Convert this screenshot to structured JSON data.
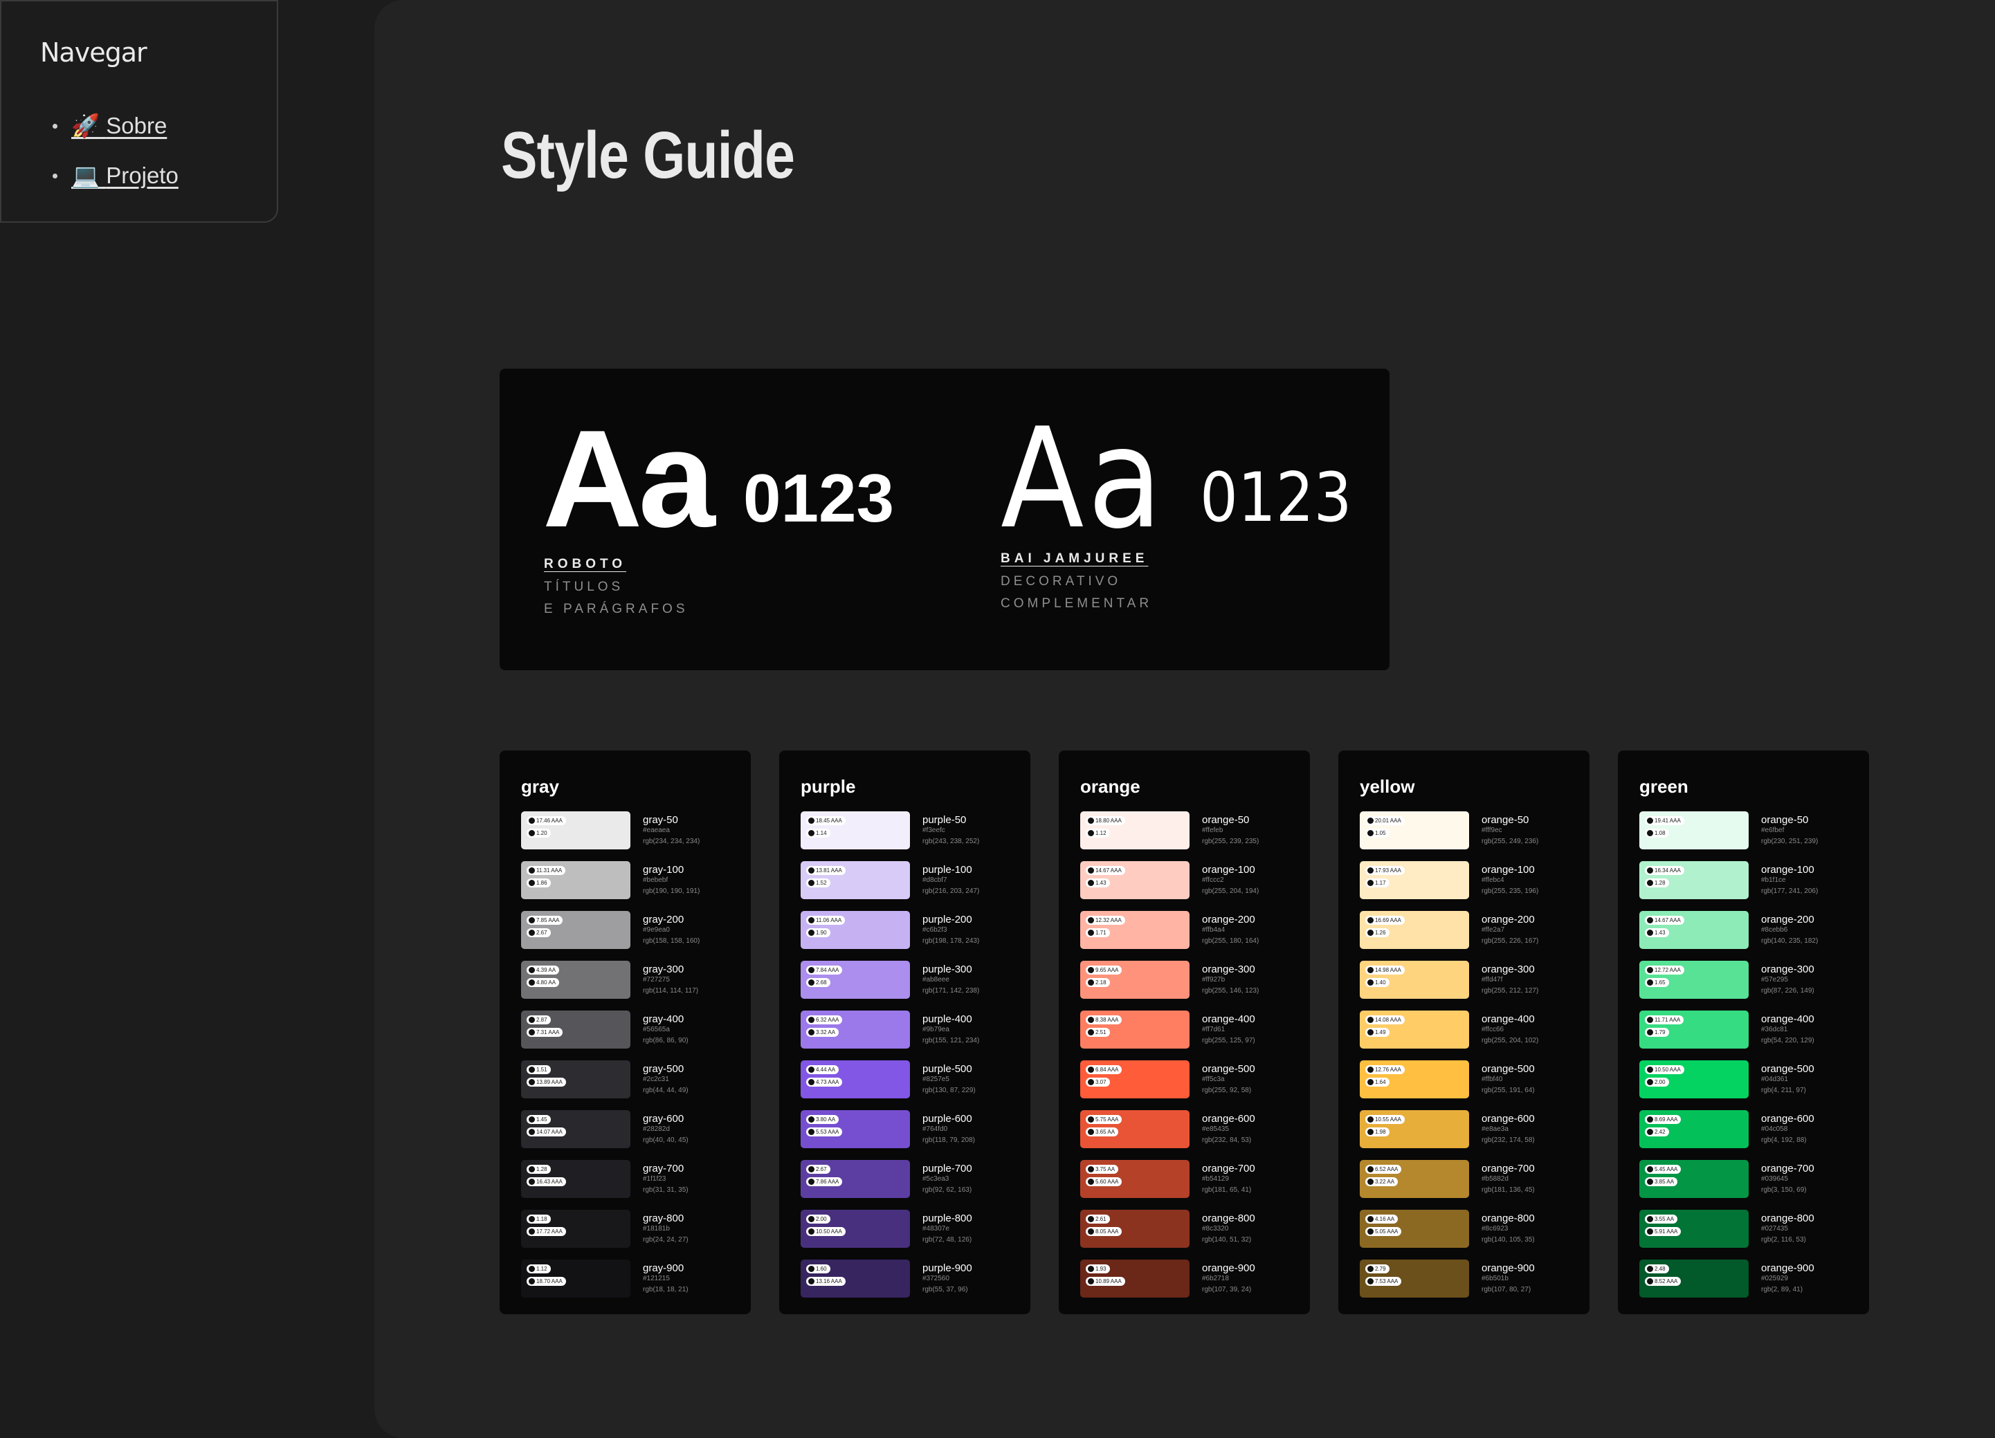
{
  "nav": {
    "title": "Navegar",
    "items": [
      {
        "icon": "🚀",
        "label": "Sobre"
      },
      {
        "icon": "💻",
        "label": "Projeto"
      }
    ]
  },
  "page": {
    "title": "Style Guide"
  },
  "typography": [
    {
      "sample": "Aa",
      "digits": "0123",
      "name": "ROBOTO",
      "desc1": "TÍTULOS",
      "desc2": "E PARÁGRAFOS"
    },
    {
      "sample": "Aa",
      "digits": "0123",
      "name": "BAI JAMJUREE",
      "desc1": "DECORATIVO",
      "desc2": "COMPLEMENTAR"
    }
  ],
  "palettes": [
    {
      "name": "gray",
      "colors": [
        {
          "label": "gray-50",
          "hex": "#eaeaea",
          "rgb": "rgb(234, 234, 234)",
          "c1": "17.46 AAA",
          "c2": "1.20",
          "color": "#eaeaea"
        },
        {
          "label": "gray-100",
          "hex": "#bebebf",
          "rgb": "rgb(190, 190, 191)",
          "c1": "11.31 AAA",
          "c2": "1.86",
          "color": "#bebebf"
        },
        {
          "label": "gray-200",
          "hex": "#9e9ea0",
          "rgb": "rgb(158, 158, 160)",
          "c1": "7.85 AAA",
          "c2": "2.67",
          "color": "#9e9ea0"
        },
        {
          "label": "gray-300",
          "hex": "#727275",
          "rgb": "rgb(114, 114, 117)",
          "c1": "4.39 AA",
          "c2": "4.80 AA",
          "color": "#727275"
        },
        {
          "label": "gray-400",
          "hex": "#56565a",
          "rgb": "rgb(86, 86, 90)",
          "c1": "2.87",
          "c2": "7.31 AAA",
          "color": "#56565a"
        },
        {
          "label": "gray-500",
          "hex": "#2c2c31",
          "rgb": "rgb(44, 44, 49)",
          "c1": "1.51",
          "c2": "13.89 AAA",
          "color": "#2c2c31"
        },
        {
          "label": "gray-600",
          "hex": "#28282d",
          "rgb": "rgb(40, 40, 45)",
          "c1": "1.45",
          "c2": "14.07 AAA",
          "color": "#28282d"
        },
        {
          "label": "gray-700",
          "hex": "#1f1f23",
          "rgb": "rgb(31, 31, 35)",
          "c1": "1.28",
          "c2": "16.43 AAA",
          "color": "#1f1f23"
        },
        {
          "label": "gray-800",
          "hex": "#18181b",
          "rgb": "rgb(24, 24, 27)",
          "c1": "1.18",
          "c2": "17.72 AAA",
          "color": "#18181b"
        },
        {
          "label": "gray-900",
          "hex": "#121215",
          "rgb": "rgb(18, 18, 21)",
          "c1": "1.12",
          "c2": "18.70 AAA",
          "color": "#121215"
        }
      ]
    },
    {
      "name": "purple",
      "colors": [
        {
          "label": "purple-50",
          "hex": "#f3eefc",
          "rgb": "rgb(243, 238, 252)",
          "c1": "18.45 AAA",
          "c2": "1.14",
          "color": "#f3eefc"
        },
        {
          "label": "purple-100",
          "hex": "#d8cbf7",
          "rgb": "rgb(216, 203, 247)",
          "c1": "13.81 AAA",
          "c2": "1.52",
          "color": "#d8cbf7"
        },
        {
          "label": "purple-200",
          "hex": "#c6b2f3",
          "rgb": "rgb(198, 178, 243)",
          "c1": "11.06 AAA",
          "c2": "1.90",
          "color": "#c6b2f3"
        },
        {
          "label": "purple-300",
          "hex": "#ab8eee",
          "rgb": "rgb(171, 142, 238)",
          "c1": "7.84 AAA",
          "c2": "2.68",
          "color": "#ab8eee"
        },
        {
          "label": "purple-400",
          "hex": "#9b79ea",
          "rgb": "rgb(155, 121, 234)",
          "c1": "6.32 AAA",
          "c2": "3.32 AA",
          "color": "#9b79ea"
        },
        {
          "label": "purple-500",
          "hex": "#8257e5",
          "rgb": "rgb(130, 87, 229)",
          "c1": "4.44 AA",
          "c2": "4.73 AAA",
          "color": "#8257e5"
        },
        {
          "label": "purple-600",
          "hex": "#764fd0",
          "rgb": "rgb(118, 79, 208)",
          "c1": "3.80 AA",
          "c2": "5.53 AAA",
          "color": "#764fd0"
        },
        {
          "label": "purple-700",
          "hex": "#5c3ea3",
          "rgb": "rgb(92, 62, 163)",
          "c1": "2.67",
          "c2": "7.86 AAA",
          "color": "#5c3ea3"
        },
        {
          "label": "purple-800",
          "hex": "#48307e",
          "rgb": "rgb(72, 48, 126)",
          "c1": "2.00",
          "c2": "10.50 AAA",
          "color": "#48307e"
        },
        {
          "label": "purple-900",
          "hex": "#372560",
          "rgb": "rgb(55, 37, 96)",
          "c1": "1.60",
          "c2": "13.16 AAA",
          "color": "#372560"
        }
      ]
    },
    {
      "name": "orange",
      "colors": [
        {
          "label": "orange-50",
          "hex": "#ffefeb",
          "rgb": "rgb(255, 239, 235)",
          "c1": "18.80 AAA",
          "c2": "1.12",
          "color": "#ffefeb"
        },
        {
          "label": "orange-100",
          "hex": "#ffccc2",
          "rgb": "rgb(255, 204, 194)",
          "c1": "14.67 AAA",
          "c2": "1.43",
          "color": "#ffccc2"
        },
        {
          "label": "orange-200",
          "hex": "#ffb4a4",
          "rgb": "rgb(255, 180, 164)",
          "c1": "12.32 AAA",
          "c2": "1.71",
          "color": "#ffb4a4"
        },
        {
          "label": "orange-300",
          "hex": "#ff927b",
          "rgb": "rgb(255, 146, 123)",
          "c1": "9.65 AAA",
          "c2": "2.18",
          "color": "#ff927b"
        },
        {
          "label": "orange-400",
          "hex": "#ff7d61",
          "rgb": "rgb(255, 125, 97)",
          "c1": "8.38 AAA",
          "c2": "2.51",
          "color": "#ff7d61"
        },
        {
          "label": "orange-500",
          "hex": "#ff5c3a",
          "rgb": "rgb(255, 92, 58)",
          "c1": "6.84 AAA",
          "c2": "3.07",
          "color": "#ff5c3a"
        },
        {
          "label": "orange-600",
          "hex": "#e85435",
          "rgb": "rgb(232, 84, 53)",
          "c1": "5.75 AAA",
          "c2": "3.65 AA",
          "color": "#e85435"
        },
        {
          "label": "orange-700",
          "hex": "#b54129",
          "rgb": "rgb(181, 65, 41)",
          "c1": "3.75 AA",
          "c2": "5.60 AAA",
          "color": "#b54129"
        },
        {
          "label": "orange-800",
          "hex": "#8c3320",
          "rgb": "rgb(140, 51, 32)",
          "c1": "2.61",
          "c2": "8.05 AAA",
          "color": "#8c3320"
        },
        {
          "label": "orange-900",
          "hex": "#6b2718",
          "rgb": "rgb(107, 39, 24)",
          "c1": "1.93",
          "c2": "10.89 AAA",
          "color": "#6b2718"
        }
      ]
    },
    {
      "name": "yellow",
      "colors": [
        {
          "label": "orange-50",
          "hex": "#fff9ec",
          "rgb": "rgb(255, 249, 236)",
          "c1": "20.01 AAA",
          "c2": "1.05",
          "color": "#fff9ec"
        },
        {
          "label": "orange-100",
          "hex": "#ffebc4",
          "rgb": "rgb(255, 235, 196)",
          "c1": "17.93 AAA",
          "c2": "1.17",
          "color": "#ffebc4"
        },
        {
          "label": "orange-200",
          "hex": "#ffe2a7",
          "rgb": "rgb(255, 226, 167)",
          "c1": "16.69 AAA",
          "c2": "1.26",
          "color": "#ffe2a7"
        },
        {
          "label": "orange-300",
          "hex": "#ffd47f",
          "rgb": "rgb(255, 212, 127)",
          "c1": "14.98 AAA",
          "c2": "1.40",
          "color": "#ffd47f"
        },
        {
          "label": "orange-400",
          "hex": "#ffcc66",
          "rgb": "rgb(255, 204, 102)",
          "c1": "14.08 AAA",
          "c2": "1.49",
          "color": "#ffcc66"
        },
        {
          "label": "orange-500",
          "hex": "#ffbf40",
          "rgb": "rgb(255, 191, 64)",
          "c1": "12.76 AAA",
          "c2": "1.64",
          "color": "#ffbf40"
        },
        {
          "label": "orange-600",
          "hex": "#e8ae3a",
          "rgb": "rgb(232, 174, 58)",
          "c1": "10.55 AAA",
          "c2": "1.98",
          "color": "#e8ae3a"
        },
        {
          "label": "orange-700",
          "hex": "#b5882d",
          "rgb": "rgb(181, 136, 45)",
          "c1": "6.52 AAA",
          "c2": "3.22 AA",
          "color": "#b5882d"
        },
        {
          "label": "orange-800",
          "hex": "#8c6923",
          "rgb": "rgb(140, 105, 35)",
          "c1": "4.16 AA",
          "c2": "5.05 AAA",
          "color": "#8c6923"
        },
        {
          "label": "orange-900",
          "hex": "#6b501b",
          "rgb": "rgb(107, 80, 27)",
          "c1": "2.79",
          "c2": "7.53 AAA",
          "color": "#6b501b"
        }
      ]
    },
    {
      "name": "green",
      "colors": [
        {
          "label": "orange-50",
          "hex": "#e6fbef",
          "rgb": "rgb(230, 251, 239)",
          "c1": "19.41 AAA",
          "c2": "1.08",
          "color": "#e6fbef"
        },
        {
          "label": "orange-100",
          "hex": "#b1f1ce",
          "rgb": "rgb(177, 241, 206)",
          "c1": "16.34 AAA",
          "c2": "1.28",
          "color": "#b1f1ce"
        },
        {
          "label": "orange-200",
          "hex": "#8cebb6",
          "rgb": "rgb(140, 235, 182)",
          "c1": "14.67 AAA",
          "c2": "1.43",
          "color": "#8cebb6"
        },
        {
          "label": "orange-300",
          "hex": "#57e295",
          "rgb": "rgb(87, 226, 149)",
          "c1": "12.72 AAA",
          "c2": "1.65",
          "color": "#57e295"
        },
        {
          "label": "orange-400",
          "hex": "#36dc81",
          "rgb": "rgb(54, 220, 129)",
          "c1": "11.71 AAA",
          "c2": "1.79",
          "color": "#36dc81"
        },
        {
          "label": "orange-500",
          "hex": "#04d361",
          "rgb": "rgb(4, 211, 97)",
          "c1": "10.50 AAA",
          "c2": "2.00",
          "color": "#04d361"
        },
        {
          "label": "orange-600",
          "hex": "#04c058",
          "rgb": "rgb(4, 192, 88)",
          "c1": "8.69 AAA",
          "c2": "2.42",
          "color": "#04c058"
        },
        {
          "label": "orange-700",
          "hex": "#039645",
          "rgb": "rgb(3, 150, 69)",
          "c1": "5.45 AAA",
          "c2": "3.85 AA",
          "color": "#039645"
        },
        {
          "label": "orange-800",
          "hex": "#027435",
          "rgb": "rgb(2, 116, 53)",
          "c1": "3.55 AA",
          "c2": "5.91 AAA",
          "color": "#027435"
        },
        {
          "label": "orange-900",
          "hex": "#025929",
          "rgb": "rgb(2, 89, 41)",
          "c1": "2.48",
          "c2": "8.52 AAA",
          "color": "#025929"
        }
      ]
    }
  ]
}
